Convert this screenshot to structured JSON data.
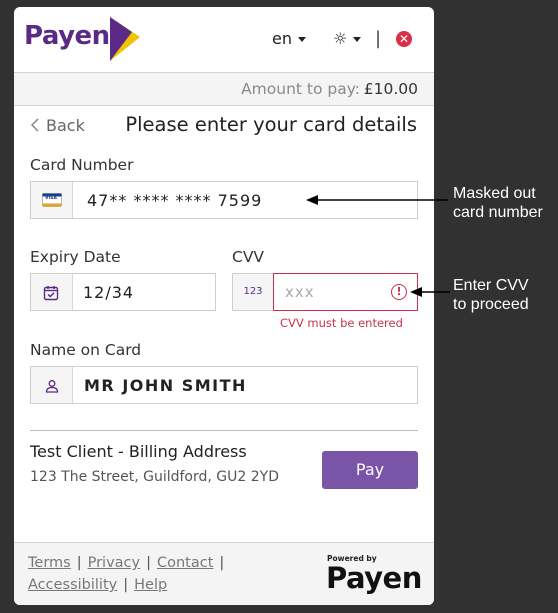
{
  "header": {
    "brand": "Payen",
    "language": "en",
    "separator": "|",
    "close_glyph": "✕",
    "theme_glyph": "☼"
  },
  "amount": {
    "label": "Amount to pay:",
    "value": "£10.00"
  },
  "nav": {
    "back_label": "Back",
    "page_title": "Please enter your card details"
  },
  "form": {
    "card_number": {
      "label": "Card Number",
      "value": "47** **** **** 7599",
      "brand_icon": "VISA"
    },
    "expiry": {
      "label": "Expiry Date",
      "value": "12/34",
      "icon": "calendar-icon"
    },
    "cvv": {
      "label": "CVV",
      "prefix": "123",
      "placeholder": "xxx",
      "error_glyph": "!",
      "error": "CVV must be entered"
    },
    "name": {
      "label": "Name on Card",
      "value": "MR JOHN SMITH",
      "icon": "user-icon"
    }
  },
  "billing": {
    "title": "Test Client - Billing Address",
    "address": "123 The Street, Guildford, GU2 2YD"
  },
  "pay_button": {
    "label": "Pay"
  },
  "footer": {
    "links": [
      "Terms",
      "Privacy",
      "Contact",
      "Accessibility",
      "Help"
    ],
    "pipe": "|",
    "powered_by": "Powered by",
    "brand": "Payen"
  },
  "annotations": {
    "card": [
      "Masked out",
      "card number"
    ],
    "cvv": [
      "Enter CVV",
      "to proceed"
    ]
  },
  "colors": {
    "brand": "#5b2a86",
    "accent": "#f2c300",
    "pay_button": "#7a54a6",
    "error": "#c7314f",
    "close": "#d9304a"
  }
}
